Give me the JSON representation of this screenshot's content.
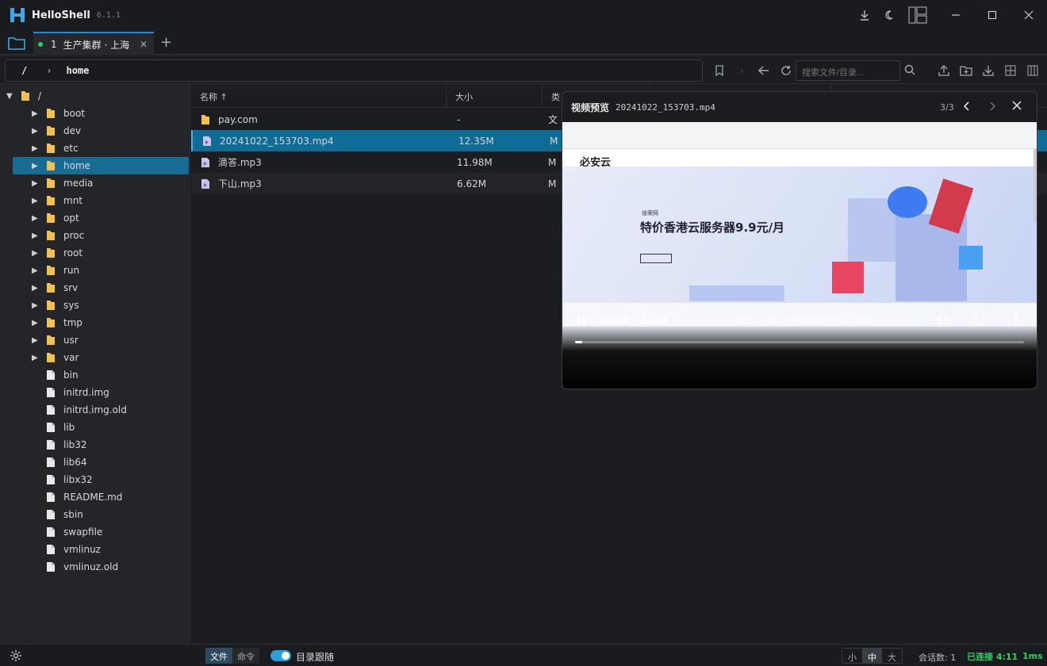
{
  "app": {
    "name": "HelloShell",
    "version": "6.1.1"
  },
  "tabs": [
    {
      "index": "1",
      "label": "生产集群 · 上海",
      "status": "connected"
    }
  ],
  "path": {
    "root": "/",
    "current": "home"
  },
  "search": {
    "placeholder": "搜索文件/目录..."
  },
  "tree": {
    "root": "/",
    "folders": [
      "boot",
      "dev",
      "etc",
      "home",
      "media",
      "mnt",
      "opt",
      "proc",
      "root",
      "run",
      "srv",
      "sys",
      "tmp",
      "usr",
      "var"
    ],
    "selected_folder": "home",
    "files": [
      "bin",
      "initrd.img",
      "initrd.img.old",
      "lib",
      "lib32",
      "lib64",
      "libx32",
      "README.md",
      "sbin",
      "swapfile",
      "vmlinuz",
      "vmlinuz.old"
    ]
  },
  "file_list": {
    "columns": [
      "名称 ↑",
      "大小",
      "类"
    ],
    "rows": [
      {
        "name": "pay.com",
        "size": "-",
        "type": "文",
        "kind": "folder"
      },
      {
        "name": "20241022_153703.mp4",
        "size": "12.35M",
        "type": "M",
        "kind": "video",
        "selected": true
      },
      {
        "name": "滴答.mp3",
        "size": "11.98M",
        "type": "M",
        "kind": "audio"
      },
      {
        "name": "下山.mp3",
        "size": "6.62M",
        "type": "M",
        "kind": "audio"
      }
    ]
  },
  "preview": {
    "title": "视频预览",
    "filename": "20241022_153703.mp4",
    "counter": "3/3",
    "time": "0:00 / 1:20",
    "progress": 0.016,
    "caption": "安全、可信、持续创新的产品与服务",
    "frame": {
      "brand": "必安云",
      "tag": "倍荣网",
      "headline": "特价香港云服务器9.9元/月"
    }
  },
  "bottom": {
    "mode_tabs": [
      "文件",
      "命令"
    ],
    "active_mode": "文件",
    "follow_label": "目录跟随",
    "follow_on": true,
    "sizes": [
      "小",
      "中",
      "大"
    ],
    "active_size": "中",
    "sessions": "会话数: 1",
    "connected": "已连接 4:11",
    "latency": "1ms"
  },
  "colors": {
    "accent": "#1c8fd6",
    "selection": "#0f6c96",
    "connected": "#2fd060",
    "folder": "#f2c14e"
  }
}
